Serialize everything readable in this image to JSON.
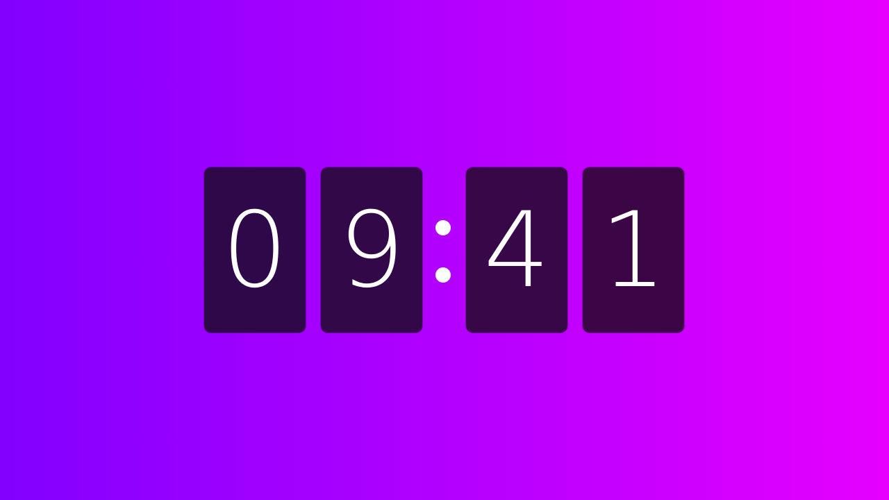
{
  "theme": {
    "background_gradient": [
      "#8200ff",
      "#a800ff",
      "#cc00ff",
      "#e600ff"
    ],
    "card_color": "#2f0a4a",
    "digit_color": "#ffffff"
  },
  "clock": {
    "hour_tens": "0",
    "hour_ones": "9",
    "minute_tens": "4",
    "minute_ones": "1",
    "separator_icon": "colon-dots"
  }
}
